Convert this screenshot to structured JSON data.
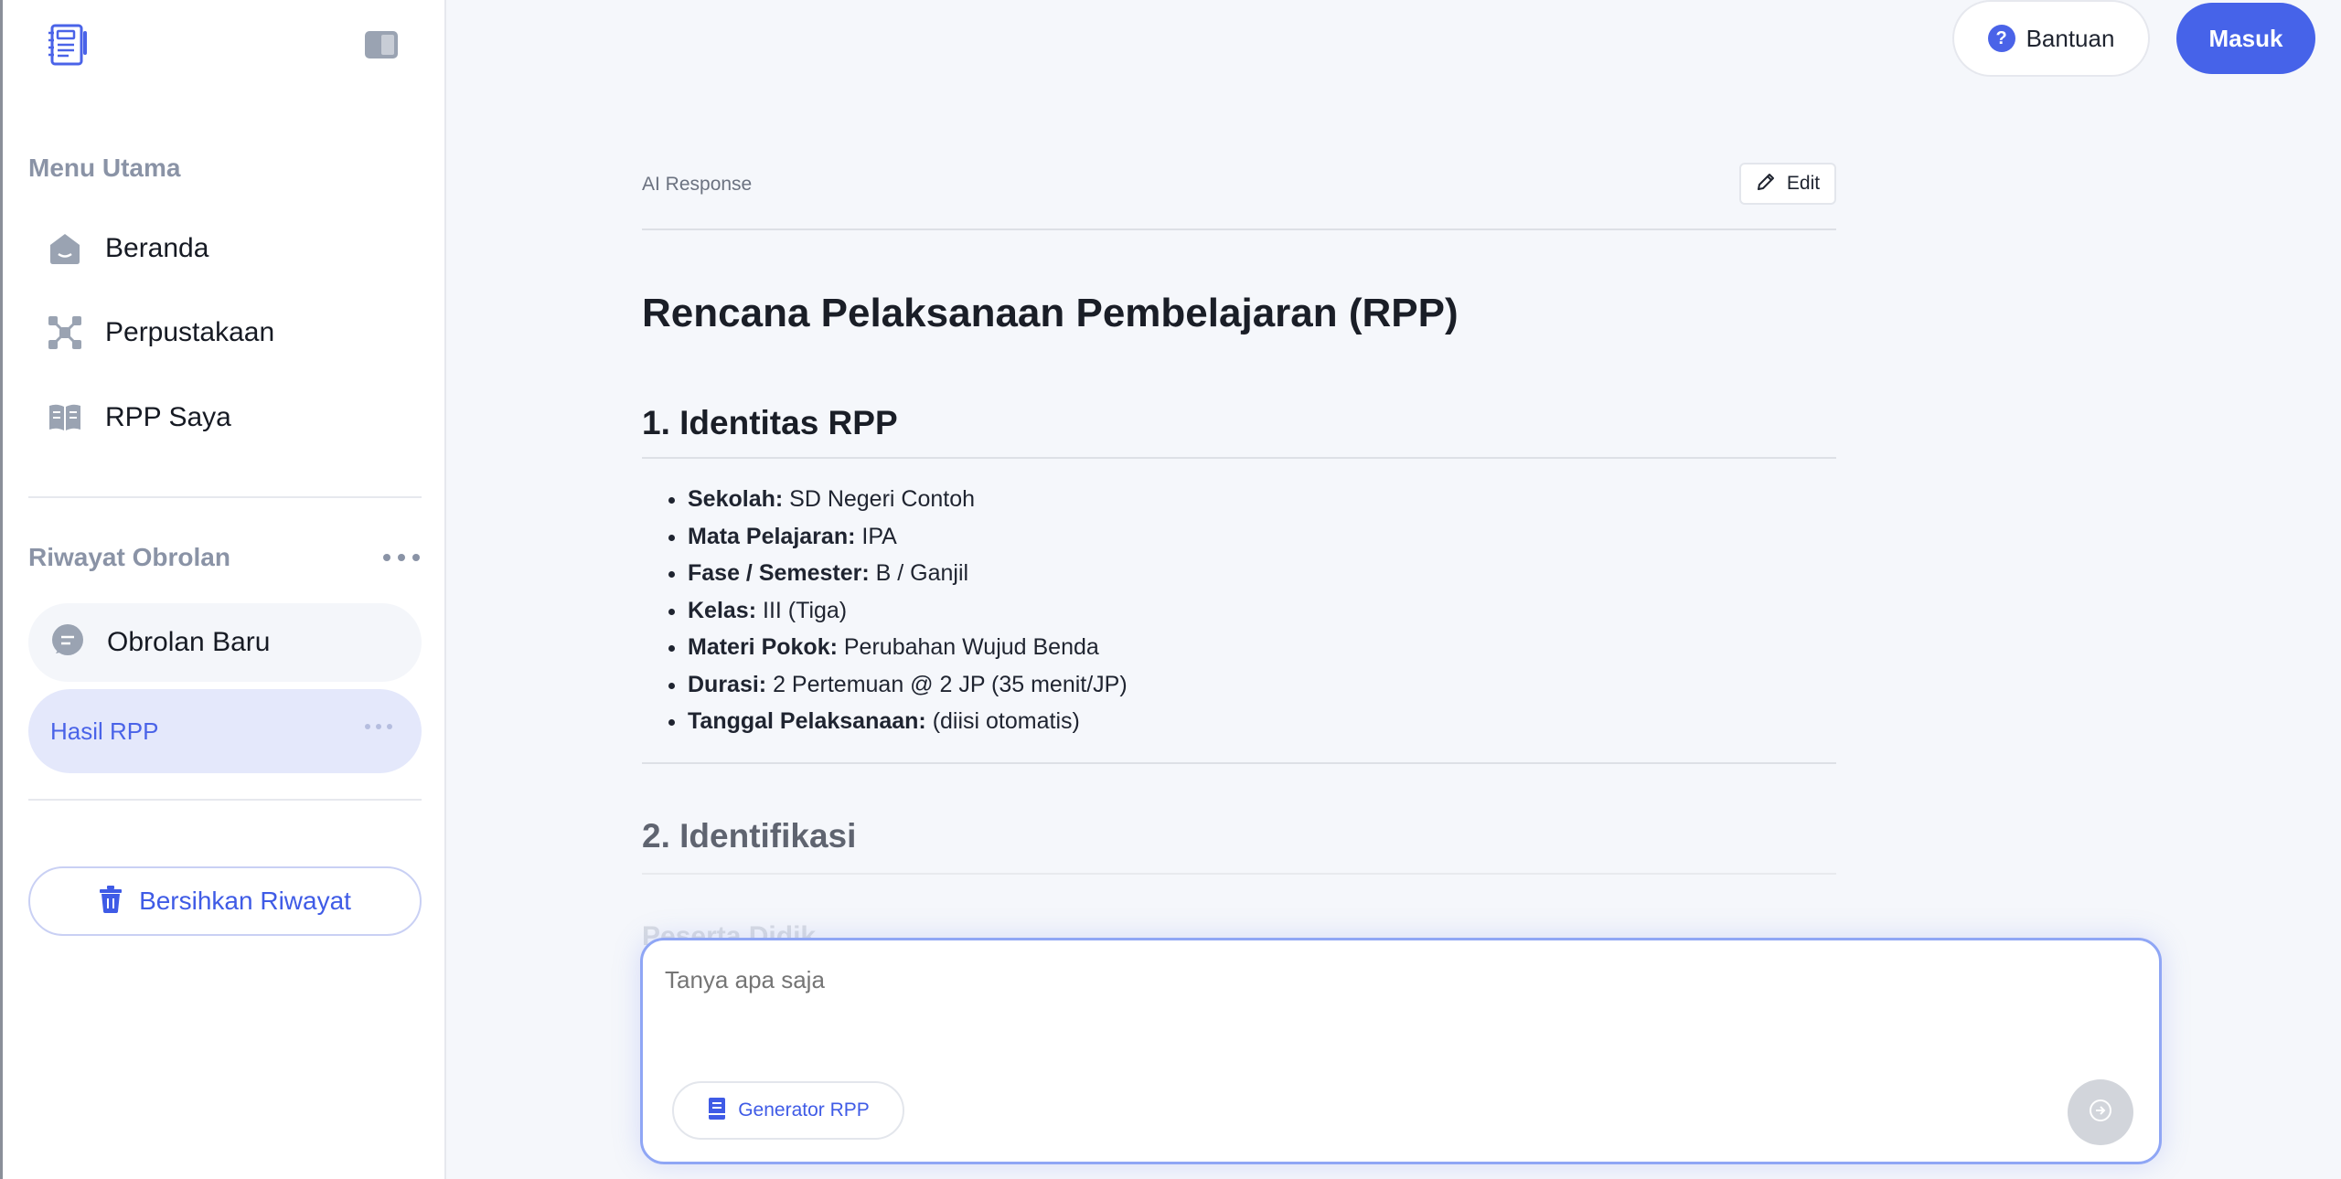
{
  "sidebar": {
    "logo_icon": "notebook-icon",
    "collapse_icon": "sidebar-toggle-icon",
    "main_menu_title": "Menu Utama",
    "nav": [
      {
        "label": "Beranda",
        "icon": "home-icon"
      },
      {
        "label": "Perpustakaan",
        "icon": "library-icon"
      },
      {
        "label": "RPP Saya",
        "icon": "book-open-icon"
      }
    ],
    "history_title": "Riwayat Obrolan",
    "chats": [
      {
        "label": "Obrolan Baru",
        "icon": "chat-icon"
      },
      {
        "label": "Hasil RPP",
        "active": true
      }
    ],
    "clear_label": "Bersihkan Riwayat"
  },
  "header": {
    "help_label": "Bantuan",
    "login_label": "Masuk"
  },
  "response": {
    "label": "AI Response",
    "edit_label": "Edit",
    "title": "Rencana Pelaksanaan Pembelajaran (RPP)",
    "section1": "1. Identitas RPP",
    "identity": [
      {
        "key": "Sekolah:",
        "value": " SD Negeri Contoh"
      },
      {
        "key": "Mata Pelajaran:",
        "value": " IPA"
      },
      {
        "key": "Fase / Semester:",
        "value": " B / Ganjil"
      },
      {
        "key": "Kelas:",
        "value": " III (Tiga)"
      },
      {
        "key": "Materi Pokok:",
        "value": " Perubahan Wujud Benda"
      },
      {
        "key": "Durasi:",
        "value": " 2 Pertemuan @ 2 JP (35 menit/JP)"
      },
      {
        "key": "Tanggal Pelaksanaan:",
        "value": " (diisi otomatis)"
      }
    ],
    "section2": "2. Identifikasi",
    "section2_sub": "Peserta Didik"
  },
  "composer": {
    "placeholder": "Tanya apa saja",
    "generator_label": "Generator RPP"
  },
  "colors": {
    "accent": "#4663e9",
    "active_chat_bg": "#e4e8fb",
    "background": "#f5f7fb"
  }
}
